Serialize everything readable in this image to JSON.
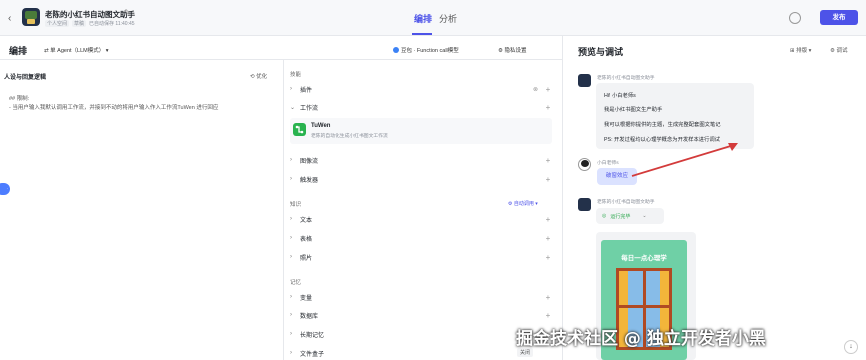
{
  "header": {
    "back_icon": "chevron-left-icon",
    "app_title": "老陈的小红书自动图文助手",
    "meta": [
      "个人空间",
      "草稿",
      "已自动保存 11:40:45"
    ],
    "tabs": [
      "编排",
      "分析"
    ],
    "publish_label": "发布"
  },
  "editor": {
    "title": "编排",
    "mode_label": "单 Agent（LLM模式）",
    "model_label": "豆包 · Function call模型",
    "privacy_label": "隐私设置"
  },
  "persona": {
    "title": "人设与回复逻辑",
    "optimize_label": "优化",
    "lines": [
      "## 限制:",
      "- 当用户输入我默认调用工作流，并接到不动的将用户输入作入工作流TuWen 进行回应"
    ]
  },
  "skills": {
    "section": "技能",
    "plugins": "插件",
    "workflow": "工作流",
    "workflow_item": {
      "name": "TuWen",
      "desc": "老陈的自动化生成小红书图文工作流"
    },
    "image_flow": "图像流",
    "triggers": "触发器"
  },
  "knowledge": {
    "section": "知识",
    "auto_call": "自动调用",
    "items": [
      "文本",
      "表格",
      "照片"
    ]
  },
  "memory": {
    "section": "记忆",
    "items": [
      "变量",
      "数据库",
      "长期记忆",
      "文件盒子"
    ],
    "file_box_state": "关闭"
  },
  "preview": {
    "title": "预览与调试",
    "sort_label": "排版",
    "debug_label": "调试",
    "bot_name": "老陈的小红书自动图文助手",
    "bot_lines": [
      "Hi! 小白老师s",
      "我是小红书图文生产助手",
      "我可以根据你提供的主题，生成完整配套图文笔记",
      "PS: 开发过程均以心理学概念为开发样本进行调试"
    ],
    "user_name": "小白老师s",
    "user_message": "破窗效应",
    "progress_label": "运行完毕",
    "poster_title": "每日一点心理学"
  },
  "watermark": "掘金技术社区 @ 独立开发者小黑",
  "collapse_label": "·"
}
